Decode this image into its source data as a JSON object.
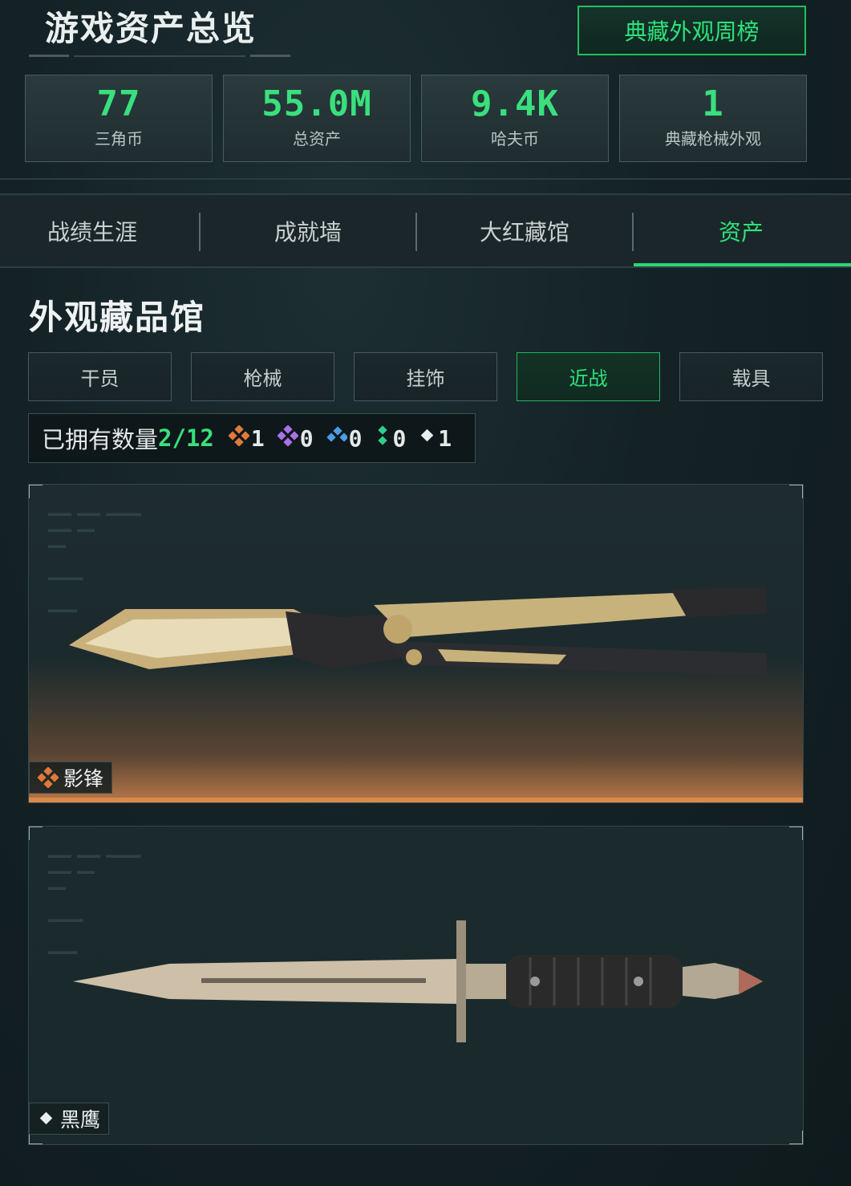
{
  "header": {
    "title": "游戏资产总览",
    "rank_button": "典藏外观周榜"
  },
  "stats": [
    {
      "value": "77",
      "label": "三角币"
    },
    {
      "value": "55.0M",
      "label": "总资产"
    },
    {
      "value": "9.4K",
      "label": "哈夫币"
    },
    {
      "value": "1",
      "label": "典藏枪械外观"
    }
  ],
  "tabs": [
    {
      "label": "战绩生涯",
      "active": false
    },
    {
      "label": "成就墙",
      "active": false
    },
    {
      "label": "大红藏馆",
      "active": false
    },
    {
      "label": "资产",
      "active": true
    }
  ],
  "section": {
    "title": "外观藏品馆",
    "categories": [
      {
        "label": "干员",
        "active": false
      },
      {
        "label": "枪械",
        "active": false
      },
      {
        "label": "挂饰",
        "active": false
      },
      {
        "label": "近战",
        "active": true
      },
      {
        "label": "载具",
        "active": false
      }
    ],
    "owned_label": "已拥有数量",
    "owned_count": "2/12",
    "rarity_counts": [
      {
        "icon": "orange-diamond-icon",
        "color": "#e07a3a",
        "count": "1"
      },
      {
        "icon": "purple-diamond-icon",
        "color": "#a872e6",
        "count": "0"
      },
      {
        "icon": "blue-diamond-icon",
        "color": "#4a9ee6",
        "count": "0"
      },
      {
        "icon": "green-diamond-icon",
        "color": "#2ecf8a",
        "count": "0"
      },
      {
        "icon": "white-diamond-icon",
        "color": "#e8eded",
        "count": "1"
      }
    ]
  },
  "items": [
    {
      "name": "影锋",
      "rarity_icon": "orange-diamond-icon",
      "rarity_color": "#e07a3a"
    },
    {
      "name": "黑鹰",
      "rarity_icon": "white-diamond-icon",
      "rarity_color": "#e8eded"
    }
  ],
  "colors": {
    "accent": "#2ee27a",
    "background": "#142226"
  }
}
